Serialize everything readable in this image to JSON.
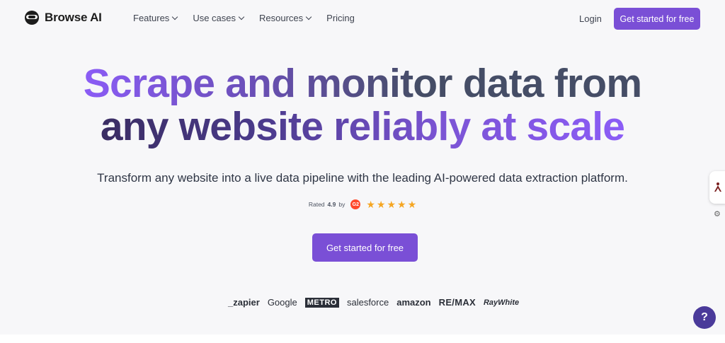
{
  "brand": {
    "name": "Browse AI"
  },
  "nav": {
    "items": [
      {
        "label": "Features",
        "dropdown": true
      },
      {
        "label": "Use cases",
        "dropdown": true
      },
      {
        "label": "Resources",
        "dropdown": true
      },
      {
        "label": "Pricing",
        "dropdown": false
      }
    ],
    "login": "Login",
    "cta": "Get started for free"
  },
  "hero": {
    "line1": "Scrape and monitor data from",
    "line2": "any website reliably at scale",
    "subtitle": "Transform any website into a live data pipeline with the leading AI-powered data extraction platform.",
    "rating_prefix": "Rated",
    "rating_value": "4.9",
    "rating_by": "by",
    "rating_source_icon": "g2-icon",
    "stars": 5,
    "cta": "Get started for free"
  },
  "logos": [
    "_zapier",
    "Google",
    "METRO",
    "salesforce",
    "amazon",
    "RE/MAX",
    "RayWhite"
  ],
  "help_label": "?",
  "colors": {
    "accent": "#7a4fd6",
    "help": "#4a3a9a",
    "star": "#f5a623",
    "g2": "#ff492c"
  }
}
